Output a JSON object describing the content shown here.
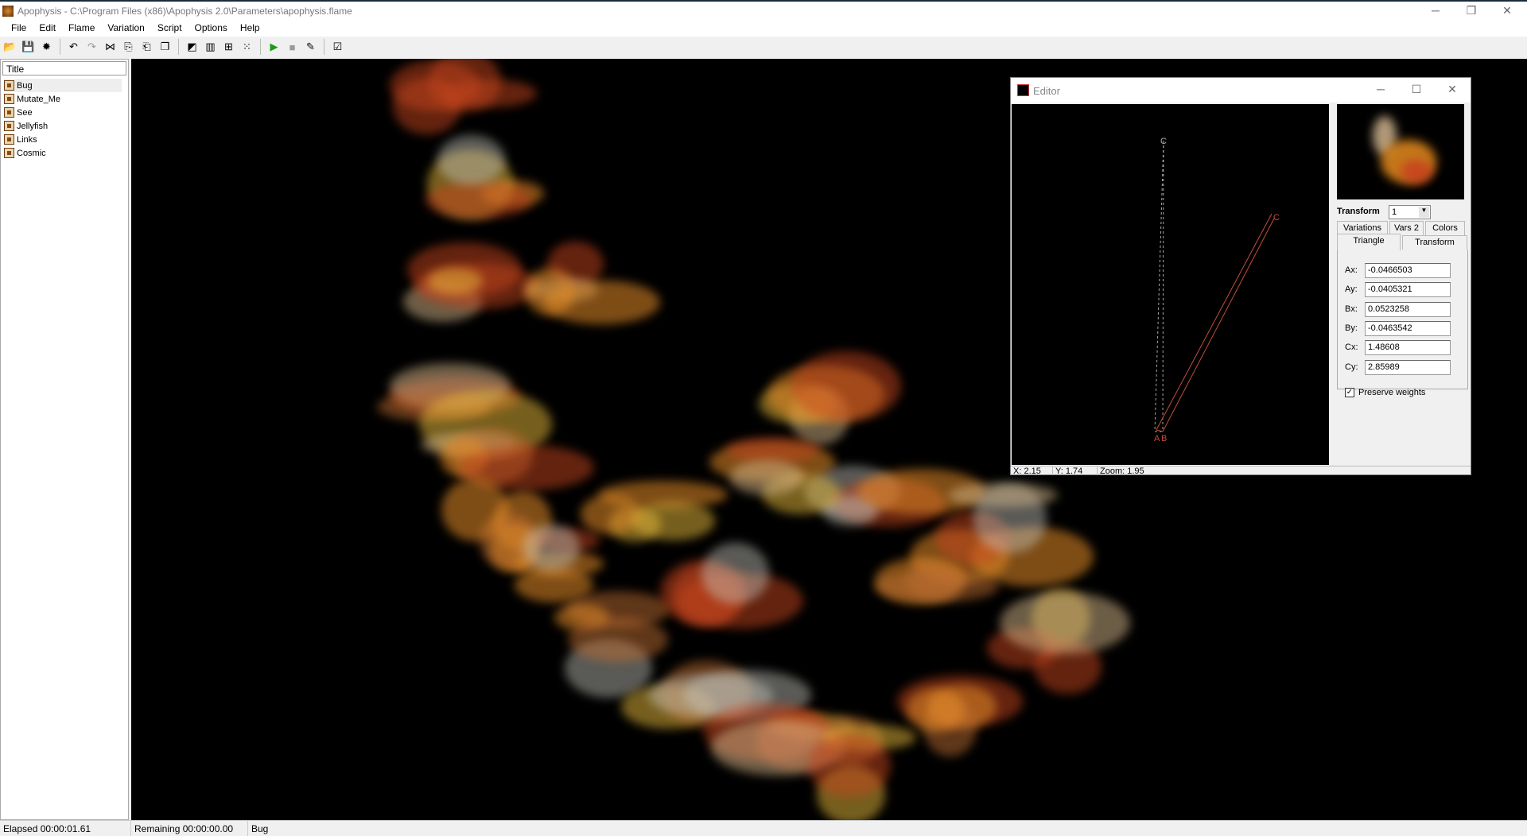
{
  "window": {
    "title": "Apophysis - C:\\Program Files (x86)\\Apophysis 2.0\\Parameters\\apophysis.flame",
    "minimize": "─",
    "maximize": "❐",
    "close": "✕"
  },
  "menu": [
    "File",
    "Edit",
    "Flame",
    "Variation",
    "Script",
    "Options",
    "Help"
  ],
  "toolbar": [
    {
      "icon": "open-icon",
      "glyph": "📂"
    },
    {
      "icon": "save-icon",
      "glyph": "💾"
    },
    {
      "icon": "random-batch-icon",
      "glyph": "✹"
    },
    {
      "sep": true
    },
    {
      "icon": "undo-icon",
      "glyph": "↶"
    },
    {
      "icon": "redo-icon",
      "glyph": "↷"
    },
    {
      "icon": "full-screen-icon",
      "glyph": "⋈"
    },
    {
      "icon": "copy-icon",
      "glyph": "⎘"
    },
    {
      "icon": "paste-icon",
      "glyph": "⎗"
    },
    {
      "icon": "duplicate-icon",
      "glyph": "❐"
    },
    {
      "sep": true
    },
    {
      "icon": "editor-icon",
      "glyph": "◩"
    },
    {
      "icon": "gradient-icon",
      "glyph": "▥"
    },
    {
      "icon": "adjust-icon",
      "glyph": "⊞"
    },
    {
      "icon": "mutate-icon",
      "glyph": "⁙"
    },
    {
      "sep": true
    },
    {
      "icon": "render-play-icon",
      "glyph": "▶"
    },
    {
      "icon": "stop-icon",
      "glyph": "■"
    },
    {
      "icon": "edit-script-icon",
      "glyph": "✎"
    },
    {
      "sep": true
    },
    {
      "icon": "options-icon",
      "glyph": "☑"
    }
  ],
  "flame_list": {
    "header": "Title",
    "items": [
      "Bug",
      "Mutate_Me",
      "See",
      "Jellyfish",
      "Links",
      "Cosmic"
    ],
    "selected": "Bug"
  },
  "status": {
    "elapsed": "Elapsed 00:00:01.61",
    "remaining": "Remaining 00:00:00.00",
    "name": "Bug"
  },
  "editor": {
    "title": "Editor",
    "minimize": "─",
    "maximize": "☐",
    "close": "✕",
    "transform_label": "Transform",
    "transform_value": "1",
    "tabs_row1": [
      "Variations",
      "Vars 2",
      "Colors"
    ],
    "tabs_row2": [
      "Triangle",
      "Transform"
    ],
    "active_tab": "Triangle",
    "fields": [
      {
        "label": "Ax:",
        "value": "-0.0466503"
      },
      {
        "label": "Ay:",
        "value": "-0.0405321"
      },
      {
        "label": "Bx:",
        "value": "0.0523258"
      },
      {
        "label": "By:",
        "value": "-0.0463542"
      },
      {
        "label": "Cx:",
        "value": "1.48608"
      },
      {
        "label": "Cy:",
        "value": "2.85989"
      }
    ],
    "preserve_weights": {
      "label": "Preserve weights",
      "checked": true
    },
    "triangle_labels": {
      "a": "A",
      "b": "B",
      "c": "C"
    },
    "status": {
      "x": "X: 2.15",
      "y": "Y: 1.74",
      "zoom": "Zoom: 1.95"
    }
  },
  "colors": {
    "accent": "#d98b2b",
    "triangle": "#c0503a",
    "reference": "#aaaaaa"
  }
}
